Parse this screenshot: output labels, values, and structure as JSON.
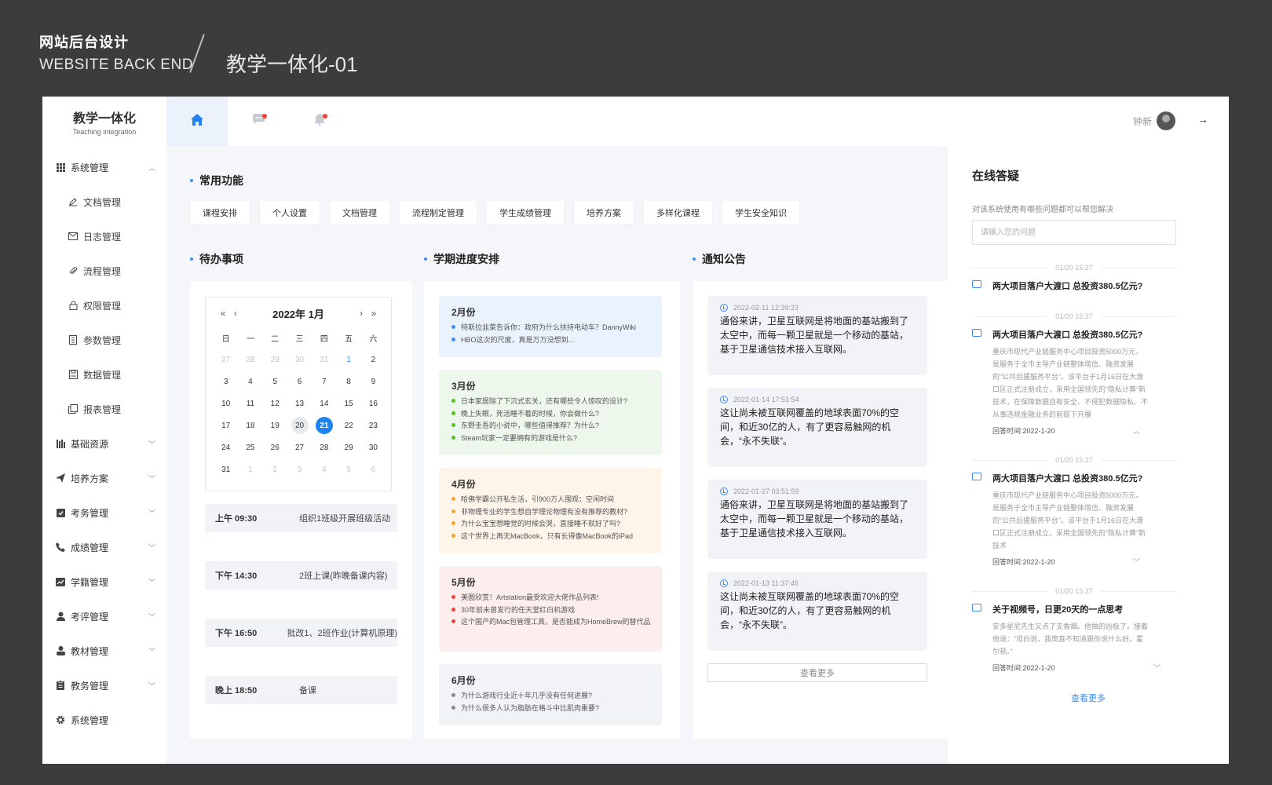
{
  "banner": {
    "title_zh": "网站后台设计",
    "title_en": "WEBSITE BACK END",
    "page_name": "教学一体化-01"
  },
  "logo": {
    "name": "教学一体化",
    "subtitle": "Teaching integration"
  },
  "sidebar": {
    "items": [
      {
        "label": "系统管理",
        "icon": "grid-icon",
        "expanded": true
      },
      {
        "label": "文档管理",
        "icon": "edit-icon",
        "sub": true
      },
      {
        "label": "日志管理",
        "icon": "mail-icon",
        "sub": true
      },
      {
        "label": "流程管理",
        "icon": "clip-icon",
        "sub": true
      },
      {
        "label": "权限管理",
        "icon": "lock-icon",
        "sub": true
      },
      {
        "label": "参数管理",
        "icon": "list-icon",
        "sub": true
      },
      {
        "label": "数据管理",
        "icon": "save-icon",
        "sub": true
      },
      {
        "label": "报表管理",
        "icon": "copy-icon",
        "sub": true
      },
      {
        "label": "基础资源",
        "icon": "bars-icon"
      },
      {
        "label": "培养方案",
        "icon": "send-icon"
      },
      {
        "label": "考务管理",
        "icon": "check-icon"
      },
      {
        "label": "成绩管理",
        "icon": "phone-icon"
      },
      {
        "label": "学籍管理",
        "icon": "chart-icon"
      },
      {
        "label": "考评管理",
        "icon": "user-icon"
      },
      {
        "label": "教材管理",
        "icon": "person-icon"
      },
      {
        "label": "教务管理",
        "icon": "clipboard-icon"
      },
      {
        "label": "系统管理",
        "icon": "gear-icon"
      }
    ]
  },
  "topbar": {
    "user_name": "钟新"
  },
  "quick": {
    "title": "常用功能",
    "buttons": [
      "课程安排",
      "个人设置",
      "文档管理",
      "流程制定管理",
      "学生成绩管理",
      "培养方案",
      "多样化课程",
      "学生安全知识"
    ]
  },
  "todo": {
    "title": "待办事项",
    "calendar": {
      "month_title": "2022年  1月",
      "weekdays": [
        "日",
        "一",
        "二",
        "三",
        "四",
        "五",
        "六"
      ],
      "days": [
        [
          "27",
          "28",
          "29",
          "30",
          "31",
          "1",
          "2"
        ],
        [
          "3",
          "4",
          "5",
          "6",
          "7",
          "8",
          "9"
        ],
        [
          "10",
          "11",
          "12",
          "13",
          "14",
          "15",
          "16"
        ],
        [
          "17",
          "18",
          "19",
          "20",
          "21",
          "22",
          "23"
        ],
        [
          "24",
          "25",
          "26",
          "27",
          "28",
          "29",
          "30"
        ],
        [
          "31",
          "1",
          "2",
          "3",
          "4",
          "5",
          "6"
        ]
      ],
      "today": "20",
      "selected": "21"
    },
    "items": [
      {
        "time": "上午 09:30",
        "text": "组织1班级开展班级活动"
      },
      {
        "time": "下午 14:30",
        "text": "2班上课(昨晚备课内容)"
      },
      {
        "time": "下午 16:50",
        "text": "批改1、2班作业(计算机原理)"
      },
      {
        "time": "晚上 18:50",
        "text": "备课"
      }
    ]
  },
  "semester": {
    "title": "学期进度安排",
    "months": [
      {
        "label": "2月份",
        "bg": "#eaf2fd",
        "dot": "#3e8ef7",
        "items": [
          "特斯拉韭菜告诉你：政府为什么扶持电动车？DannyWiki",
          "HBO这次的尺度，真是万万没想到..."
        ]
      },
      {
        "label": "3月份",
        "bg": "#edf7ec",
        "dot": "#52c41a",
        "items": [
          "日本家居除了下沉式玄关，还有哪些令人惊叹的设计?",
          "晚上失眠，死活睡不着的时候，你会做什么?",
          "东野圭吾的小说中，哪些值得推荐？为什么?",
          "Steam玩家一定要拥有的游戏是什么?"
        ]
      },
      {
        "label": "4月份",
        "bg": "#fdf4ea",
        "dot": "#f5a623",
        "items": [
          "哈佛学霸公开私生活，引900万人围观：空闲时间",
          "非物理专业的学生想自学理论物理有没有推荐的教材?",
          "为什么宝宝想睡觉的时候会哭，直接睡不就好了吗?",
          "这个世界上再无MacBook，只有长得像MacBook的iPad"
        ]
      },
      {
        "label": "5月份",
        "bg": "#fdeeee",
        "dot": "#f04134",
        "items": [
          "美图欣赏！Artstation最受欢迎大佬作品列表!",
          "30年前未曾发行的任天堂红白机游戏",
          "这个国产的Mac包管理工具，是否能成为HomeBrew的替代品"
        ]
      },
      {
        "label": "6月份",
        "bg": "#f1f3f6",
        "dot": "#888888",
        "items": [
          "为什么游戏行业近十年几乎没有任何进展?",
          "为什么很多人认为脂肪在格斗中比肌肉重要?"
        ]
      }
    ]
  },
  "notices": {
    "title": "通知公告",
    "items": [
      {
        "time": "2022-02-11 12:39:23",
        "text": "通俗来讲，卫星互联网是将地面的基站搬到了太空中，而每一颗卫星就是一个移动的基站，基于卫星通信技术接入互联网。"
      },
      {
        "time": "2022-01-14 17:51:54",
        "text": "这让尚未被互联网覆盖的地球表面70%的空间，和近30亿的人，有了更容易触网的机会，“永不失联”。"
      },
      {
        "time": "2022-01-27 03:51:59",
        "text": "通俗来讲，卫星互联网是将地面的基站搬到了太空中，而每一颗卫星就是一个移动的基站，基于卫星通信技术接入互联网。"
      },
      {
        "time": "2022-01-13 11:37:45",
        "text": "这让尚未被互联网覆盖的地球表面70%的空间，和近30亿的人，有了更容易触网的机会，“永不失联”。"
      }
    ],
    "more": "查看更多"
  },
  "qa": {
    "title": "在线答疑",
    "subtitle": "对该系统使用有哪些问题都可以帮您解决",
    "placeholder": "请输入您的问题",
    "items": [
      {
        "time": "01/20 15:27",
        "question": "两大项目落户大渡口 总投资380.5亿元?",
        "body": "",
        "answer_time": ""
      },
      {
        "time": "01/20 15:27",
        "question": "两大项目落户大渡口 总投资380.5亿元?",
        "body": "重庆市现代产业链服务中心项目投资5000万元，是服务于全市主导产业链整体增信、融资发展的“公共后援服务平台”。该平台于1月16日在大渡口区正式注册成立，采用全国领先的“隐私计算”新技术，在保障数据自有安全、不侵犯数据隐私、不从事违规金融业务的前提下开展",
        "answer_time": "回答时间:2022-1-20"
      },
      {
        "time": "01/20 15:27",
        "question": "两大项目落户大渡口 总投资380.5亿元?",
        "body": "重庆市现代产业链服务中心项目投资5000万元，是服务于全市主导产业链整体增信、融资发展的“公共后援服务平台”。该平台于1月16日在大渡口区正式注册成立，采用全国领先的“隐私计算”新技术",
        "answer_time": "回答时间:2022-1-20"
      },
      {
        "time": "01/20 15:27",
        "question": "关于视频号，日更20天的一点思考",
        "body": "安多星尼先生又点了支香烟。他抽的凶极了。接着他说：“坦白说，我简直不知道跟你说什么好。霍尔顿。”",
        "answer_time": "回答时间:2022-1-20"
      }
    ],
    "more": "查看更多"
  }
}
